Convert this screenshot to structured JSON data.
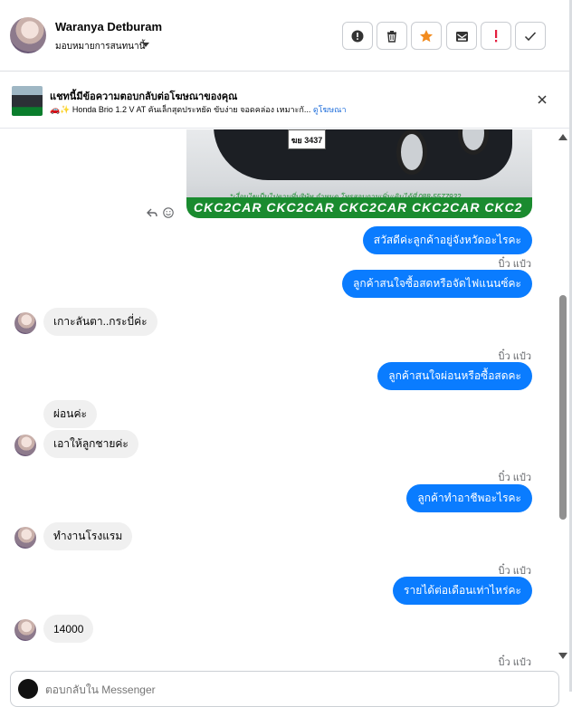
{
  "header": {
    "name": "Waranya Detburam",
    "assign_label": "มอบหมายการสนทนานี้",
    "actions": [
      {
        "icon": "alert-circle-icon",
        "color": "#333333"
      },
      {
        "icon": "trash-icon",
        "color": "#333333"
      },
      {
        "icon": "star-icon",
        "color": "#f28b1e"
      },
      {
        "icon": "mark-unread-icon",
        "color": "#333333"
      },
      {
        "icon": "exclamation-icon",
        "color": "#e41e3f"
      },
      {
        "icon": "check-icon",
        "color": "#333333"
      }
    ]
  },
  "ad_banner": {
    "title": "แชทนี้มีข้อความตอบกลับต่อโฆษณาของคุณ",
    "subtitle": "🚗✨ Honda Brio 1.2 V AT คันเล็กสุดประหยัด ขับง่าย จอดคล่อง เหมาะกั...",
    "link": "ดูโฆษณา"
  },
  "ad_image": {
    "plate": "ฆย 3437",
    "caption": "*เงื่อนไขเป็นไปตามที่บริษัท กำหนด โทรสอบถามเพิ่มเติมได้ที่ 088-5577932",
    "banner": "CKC2CAR CKC2CAR CKC2CAR CKC2CAR CKC2"
  },
  "messages": [
    {
      "dir": "out",
      "text": "สวัสดีค่ะลูกค้าอยู่จังหวัดอะไรคะ"
    },
    {
      "dir": "out",
      "sender": "บิ๋ว แป๋ว",
      "text": "ลูกค้าสนใจซื้อสดหรือจัดไฟแนนซ์คะ"
    },
    {
      "dir": "in",
      "text": "เกาะลันตา..กระบี่ค่ะ"
    },
    {
      "dir": "out",
      "sender": "บิ๋ว แป๋ว",
      "text": "ลูกค้าสนใจผ่อนหรือซื้อสดคะ"
    },
    {
      "dir": "in",
      "text": "ผ่อนค่ะ"
    },
    {
      "dir": "in",
      "text": "เอาให้ลูกชายค่ะ"
    },
    {
      "dir": "out",
      "sender": "บิ๋ว แป๋ว",
      "text": "ลูกค้าทำอาชีพอะไรคะ"
    },
    {
      "dir": "in",
      "text": "ทำงานโรงแรม"
    },
    {
      "dir": "out",
      "sender": "บิ๋ว แป๋ว",
      "text": "รายได้ต่อเดือนเท่าไหร่คะ"
    },
    {
      "dir": "in",
      "text": "14000"
    },
    {
      "dir": "out",
      "sender": "บิ๋ว แป๋ว"
    }
  ],
  "composer": {
    "placeholder": "ตอบกลับใน Messenger"
  }
}
